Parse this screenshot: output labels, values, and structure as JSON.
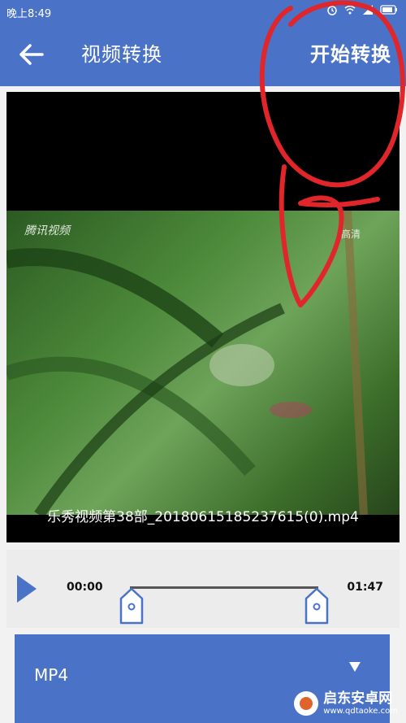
{
  "status_bar": {
    "time": "晚上8:49"
  },
  "app_bar": {
    "title": "视频转换",
    "start_label": "开始转换",
    "back_icon": "arrow-left-icon"
  },
  "video": {
    "watermark_left": "腾讯视频",
    "watermark_right": "高清",
    "file_name": "乐秀视频第38部_20180615185237615(0).mp4"
  },
  "player": {
    "current_time": "00:00",
    "total_time": "01:47",
    "play_icon": "play-icon"
  },
  "format": {
    "selected": "MP4",
    "arrow_icon": "chevron-down-icon"
  },
  "site_badge": {
    "name": "启东安卓网",
    "url": "www.qdtaoke.com"
  },
  "colors": {
    "primary": "#4a73c8",
    "annotation": "#e0262b"
  }
}
